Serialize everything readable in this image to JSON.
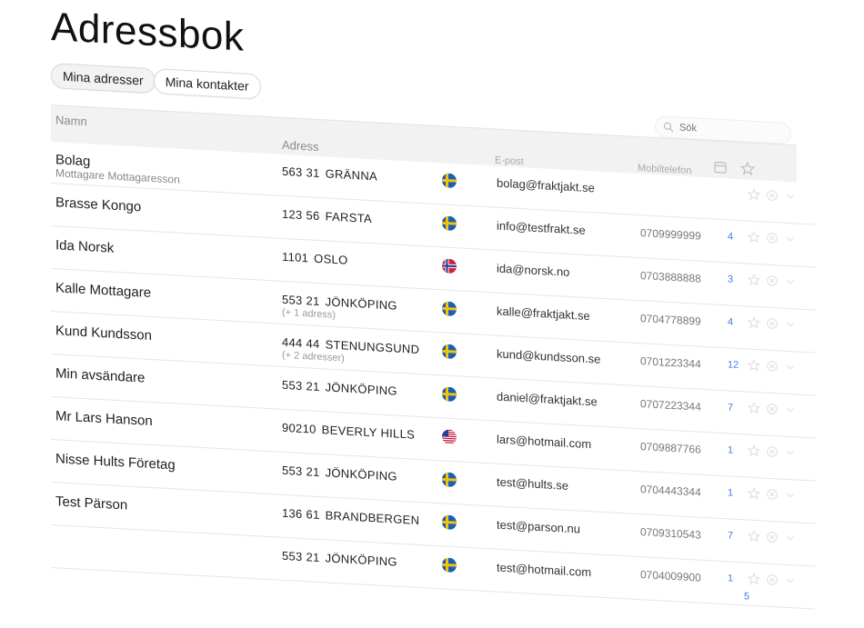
{
  "page_title": "Adressbok",
  "tabs": [
    {
      "label": "Mina adresser",
      "active": true
    },
    {
      "label": "Mina kontakter",
      "active": false
    }
  ],
  "search": {
    "placeholder": "Sök"
  },
  "columns": {
    "name": "Namn",
    "address": "Adress",
    "email": "E-post",
    "mobile": "Mobiltelefon"
  },
  "colors": {
    "accent": "#3a7de0",
    "sweden_blue": "#1a5fb4",
    "sweden_yellow": "#f4c20d"
  },
  "rows": [
    {
      "name": "Bolag",
      "sub": "Mottagare Mottagaresson",
      "zip": "563 31",
      "city": "GRÄNNA",
      "extra": "",
      "flag": "se",
      "email": "bolag@fraktjakt.se",
      "phone": "",
      "count": ""
    },
    {
      "name": "Brasse Kongo",
      "sub": "",
      "zip": "123 56",
      "city": "FARSTA",
      "extra": "",
      "flag": "se",
      "email": "info@testfrakt.se",
      "phone": "0709999999",
      "count": "4"
    },
    {
      "name": "Ida Norsk",
      "sub": "",
      "zip": "1101",
      "city": "OSLO",
      "extra": "",
      "flag": "no",
      "email": "ida@norsk.no",
      "phone": "0703888888",
      "count": "3"
    },
    {
      "name": "Kalle Mottagare",
      "sub": "",
      "zip": "553 21",
      "city": "JÖNKÖPING",
      "extra": "(+ 1 adress)",
      "flag": "se",
      "email": "kalle@fraktjakt.se",
      "phone": "0704778899",
      "count": "4"
    },
    {
      "name": "Kund Kundsson",
      "sub": "",
      "zip": "444 44",
      "city": "STENUNGSUND",
      "extra": "(+ 2 adresser)",
      "flag": "se",
      "email": "kund@kundsson.se",
      "phone": "0701223344",
      "count": "12"
    },
    {
      "name": "Min avsändare",
      "sub": "",
      "zip": "553 21",
      "city": "JÖNKÖPING",
      "extra": "",
      "flag": "se",
      "email": "daniel@fraktjakt.se",
      "phone": "0707223344",
      "count": "7"
    },
    {
      "name": "Mr Lars Hanson",
      "sub": "",
      "zip": "90210",
      "city": "BEVERLY HILLS",
      "extra": "",
      "flag": "us",
      "email": "lars@hotmail.com",
      "phone": "0709887766",
      "count": "1"
    },
    {
      "name": "Nisse Hults Företag",
      "sub": "",
      "zip": "553 21",
      "city": "JÖNKÖPING",
      "extra": "",
      "flag": "se",
      "email": "test@hults.se",
      "phone": "0704443344",
      "count": "1"
    },
    {
      "name": "Test Pärson",
      "sub": "",
      "zip": "136 61",
      "city": "BRANDBERGEN",
      "extra": "",
      "flag": "se",
      "email": "test@parson.nu",
      "phone": "0709310543",
      "count": "7"
    },
    {
      "name": "",
      "sub": "",
      "zip": "553 21",
      "city": "JÖNKÖPING",
      "extra": "",
      "flag": "se",
      "email": "test@hotmail.com",
      "phone": "0704009900",
      "count": "1"
    }
  ],
  "trailing_count": "5"
}
